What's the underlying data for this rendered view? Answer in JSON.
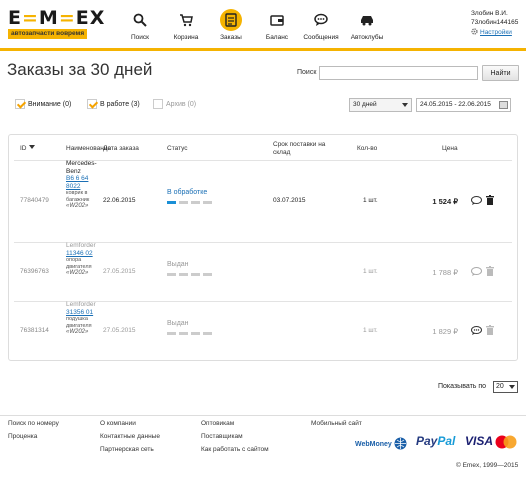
{
  "header": {
    "logo": "EMEX",
    "tagline": "автозапчасти вовремя",
    "nav": [
      {
        "label": "Поиск",
        "icon": "search-icon"
      },
      {
        "label": "Корзина",
        "icon": "cart-icon"
      },
      {
        "label": "Заказы",
        "icon": "orders-icon",
        "active": true
      },
      {
        "label": "Баланс",
        "icon": "wallet-icon"
      },
      {
        "label": "Сообщения",
        "icon": "chat-icon"
      },
      {
        "label": "Автоклубы",
        "icon": "car-icon"
      }
    ],
    "user_name": "Злобин В.И.",
    "user_id": "73лобин144165",
    "settings_label": "Настройки"
  },
  "page": {
    "title": "Заказы за 30 дней",
    "search_label": "Поиск",
    "search_value": "",
    "search_button": "Найти"
  },
  "filters": {
    "attention": "Внимание (0)",
    "in_work": "В работе (3)",
    "archive": "Архив (0)",
    "period": "30 дней",
    "date_range": "24.05.2015 - 22.06.2015"
  },
  "table": {
    "headers": {
      "id": "ID",
      "name": "Наименование",
      "date": "Дата заказа",
      "status": "Статус",
      "delivery": "Срок поставки на склад",
      "qty": "Кол-во",
      "price": "Цена"
    },
    "rows": [
      {
        "id": "77840479",
        "brand": "Mercedes-Benz",
        "code": "B6 6 64 8022",
        "desc": "коврик в багажник",
        "model": "W202",
        "date": "22.06.2015",
        "status": "В обработке",
        "progress": 1,
        "delivery": "03.07.2015",
        "qty": "1 шт.",
        "price": "1 524 ₽"
      },
      {
        "id": "76396763",
        "brand": "Lemforder",
        "code": "11346 02",
        "desc": "опора двигателя",
        "model": "W202",
        "date": "27.05.2015",
        "status": "Выдан",
        "progress": 0,
        "delivery": "",
        "qty": "1 шт.",
        "price": "1 788 ₽"
      },
      {
        "id": "76381314",
        "brand": "Lemforder",
        "code": "31356 01",
        "desc": "подушка двигателя",
        "model": "W202",
        "date": "27.05.2015",
        "status": "Выдан",
        "progress": 0,
        "delivery": "",
        "qty": "1 шт.",
        "price": "1 829 ₽"
      }
    ]
  },
  "pagination": {
    "show_label": "Показывать по",
    "show_value": "20"
  },
  "footer": {
    "col1": [
      "Поиск по номеру",
      "Проценка"
    ],
    "col2": [
      "О компании",
      "Контактные данные",
      "Партнерская сеть"
    ],
    "col3": [
      "Оптовикам",
      "Поставщикам",
      "Как работать с сайтом"
    ],
    "col4": [
      "Мобильный сайт"
    ],
    "payments": {
      "webmoney": "WebMoney",
      "paypal_a": "Pay",
      "paypal_b": "Pal",
      "visa": "VISA"
    },
    "copyright": "© Emex, 1999—2015"
  },
  "colors": {
    "accent": "#f5b301",
    "link": "#1a6fb5"
  }
}
